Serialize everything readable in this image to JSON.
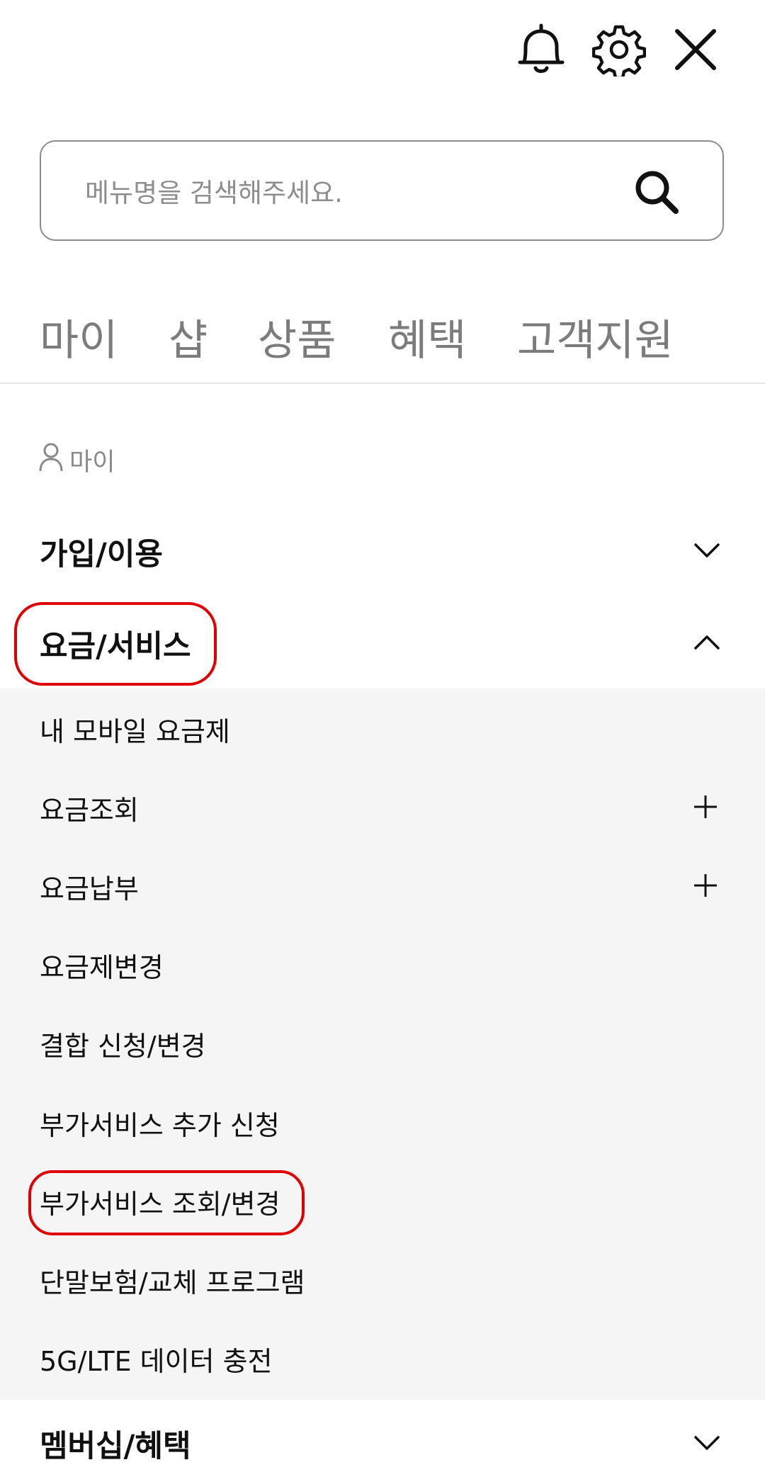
{
  "header": {
    "bell_icon": "bell-icon",
    "settings_icon": "gear-icon",
    "close_icon": "close-icon"
  },
  "search": {
    "placeholder": "메뉴명을 검색해주세요.",
    "value": ""
  },
  "tabs": [
    {
      "label": "마이"
    },
    {
      "label": "샵"
    },
    {
      "label": "상품"
    },
    {
      "label": "혜택"
    },
    {
      "label": "고객지원"
    }
  ],
  "section": {
    "label": "마이"
  },
  "menu": {
    "join_use": "가입/이용",
    "fee_service": "요금/서비스",
    "membership": "멤버십/혜택",
    "sub_items": [
      {
        "label": "내 모바일 요금제",
        "expandable": false
      },
      {
        "label": "요금조회",
        "expandable": true
      },
      {
        "label": "요금납부",
        "expandable": true
      },
      {
        "label": "요금제변경",
        "expandable": false
      },
      {
        "label": "결합 신청/변경",
        "expandable": false
      },
      {
        "label": "부가서비스 추가 신청",
        "expandable": false
      },
      {
        "label": "부가서비스 조회/변경",
        "expandable": false
      },
      {
        "label": "단말보험/교체 프로그램",
        "expandable": false
      },
      {
        "label": "5G/LTE 데이터 충전",
        "expandable": false
      }
    ]
  },
  "colors": {
    "highlight": "#e00000",
    "panel_bg": "#f5f5f5",
    "tab_text": "#7c7c7c"
  }
}
